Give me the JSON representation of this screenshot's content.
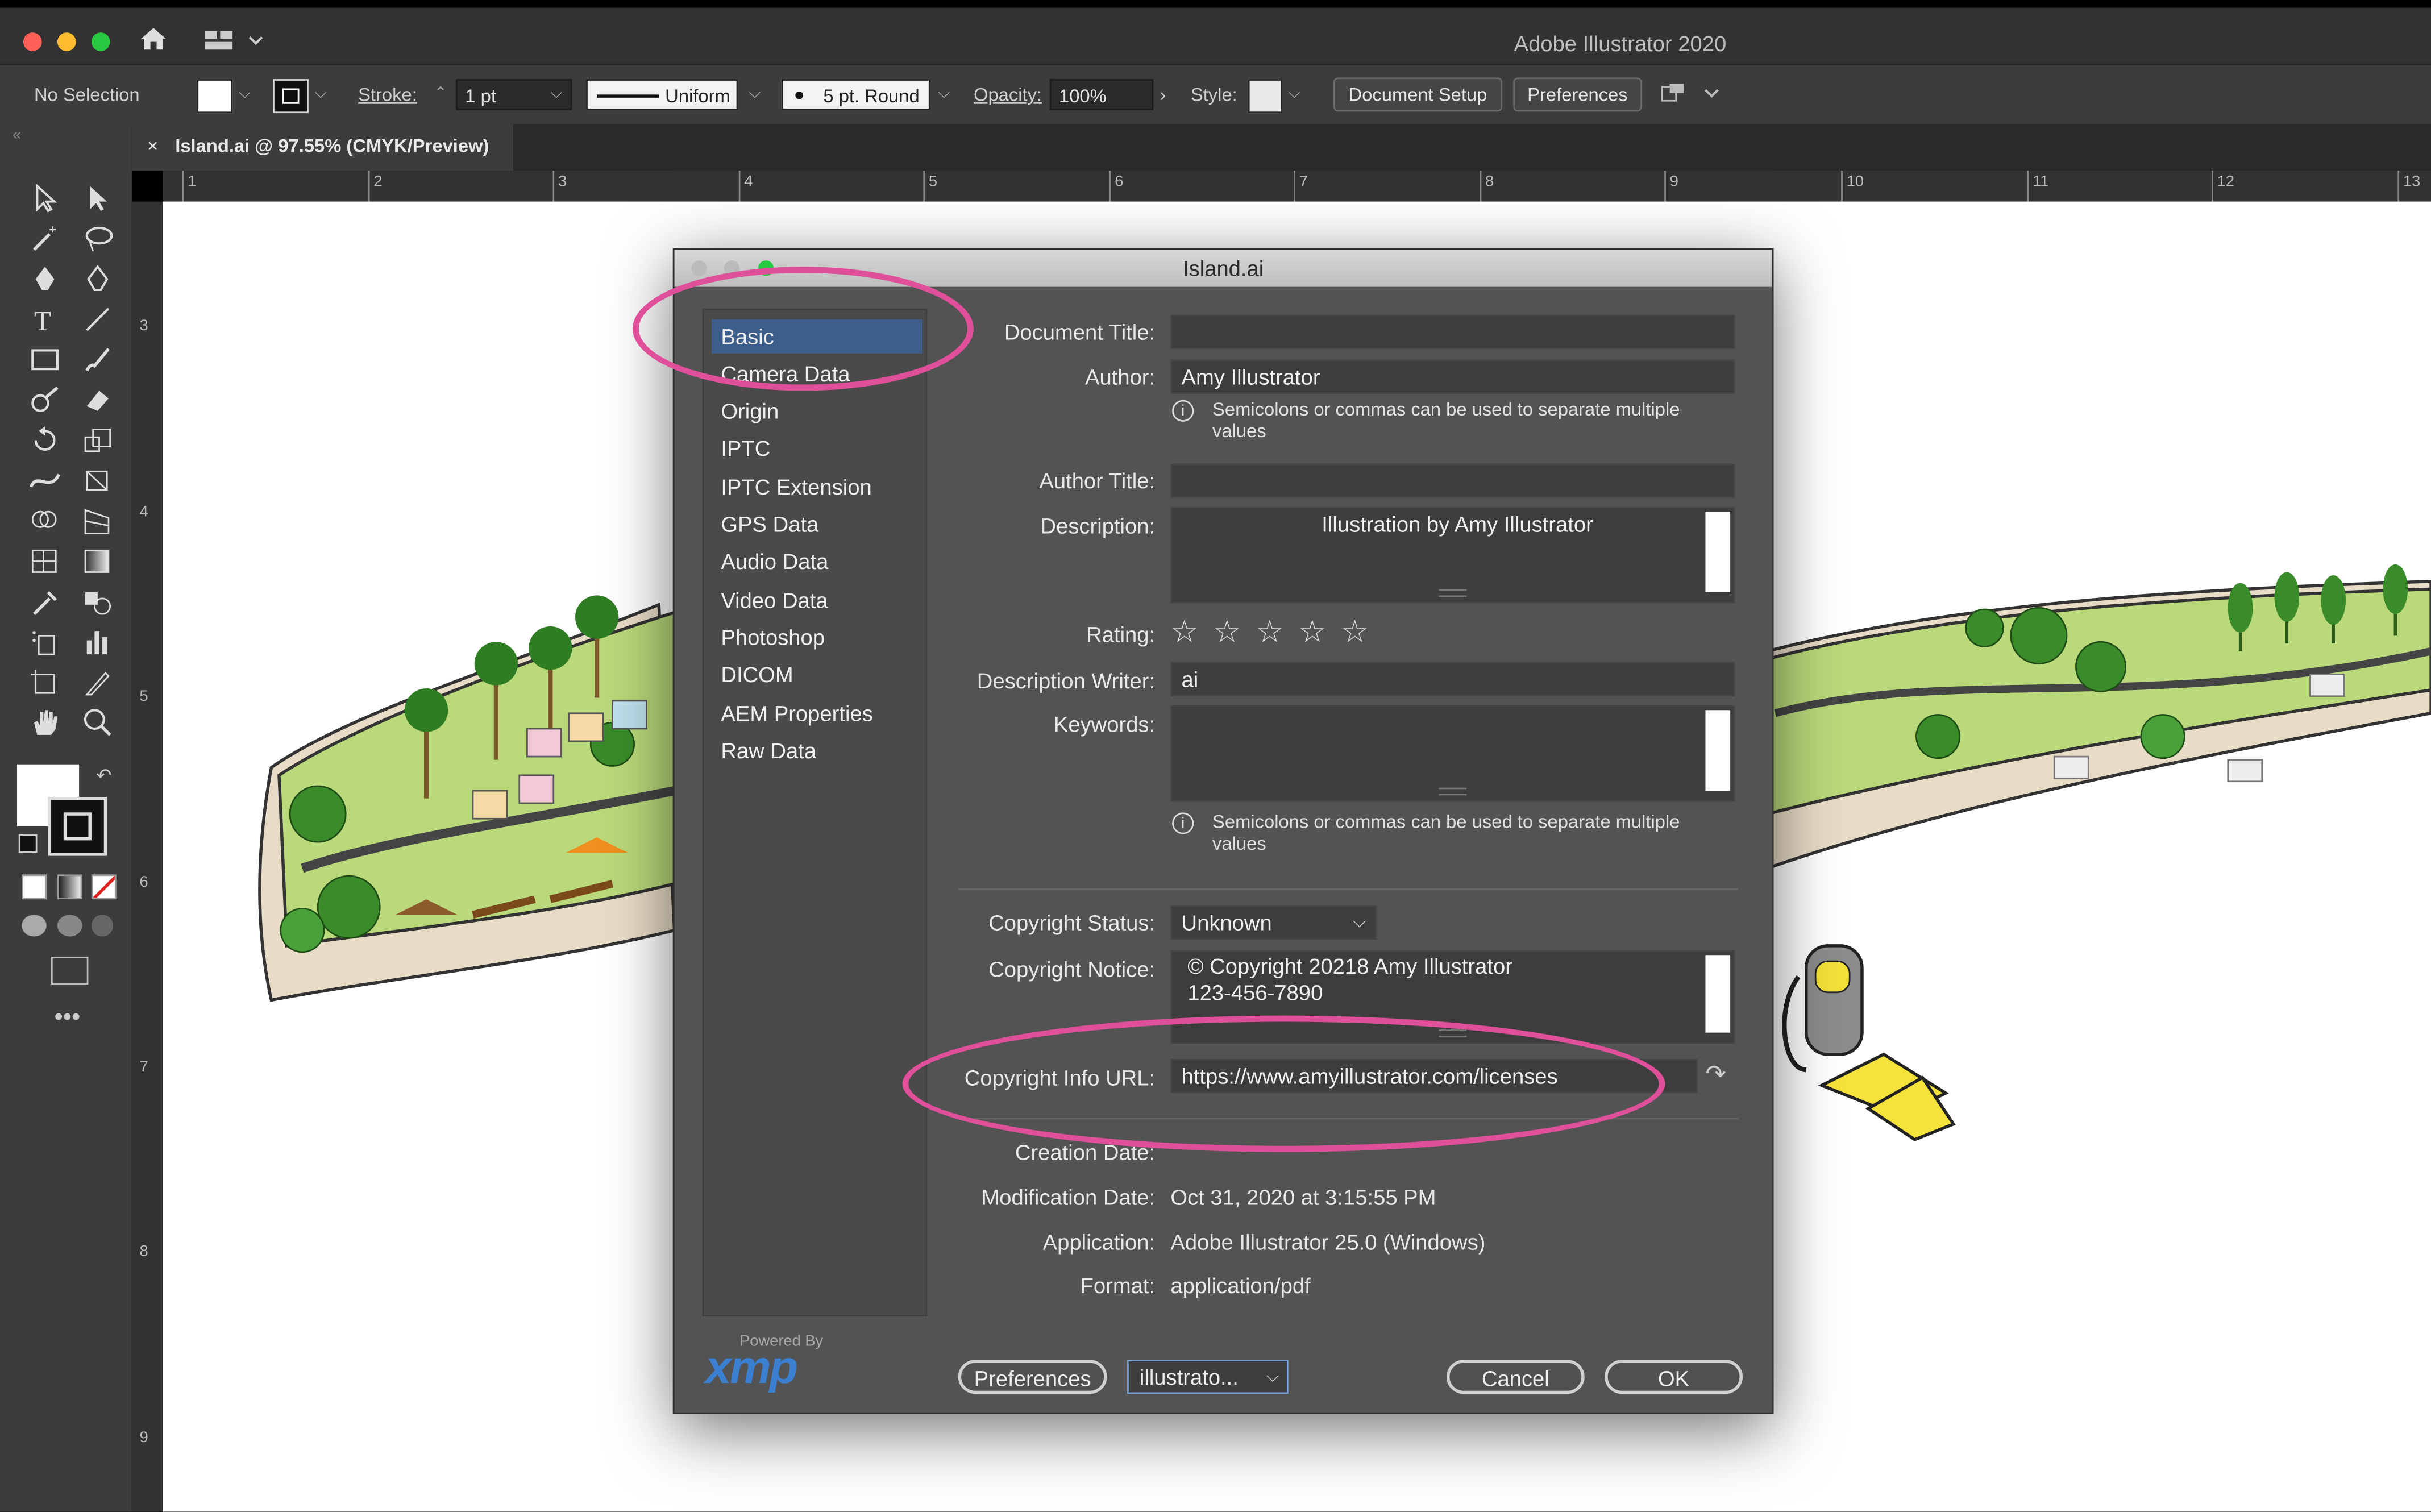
{
  "app": {
    "title": "Adobe Illustrator 2020"
  },
  "control_bar": {
    "selection": "No Selection",
    "stroke_label": "Stroke:",
    "stroke_weight": "1 pt",
    "stroke_profile": "Uniform",
    "brush": "5 pt. Round",
    "opacity_label": "Opacity:",
    "opacity_value": "100%",
    "style_label": "Style:",
    "document_setup": "Document Setup",
    "preferences": "Preferences"
  },
  "tab": {
    "close": "×",
    "label": "Island.ai @ 97.55% (CMYK/Preview)"
  },
  "ruler": {
    "h_ticks": [
      "1",
      "2",
      "3",
      "4",
      "5",
      "6",
      "7",
      "8",
      "9",
      "10",
      "11",
      "12",
      "13"
    ],
    "v_ticks": [
      "3",
      "4",
      "5",
      "6",
      "7",
      "8",
      "9"
    ]
  },
  "dialog": {
    "title": "Island.ai",
    "sidebar": [
      "Basic",
      "Camera Data",
      "Origin",
      "IPTC",
      "IPTC Extension",
      "GPS Data",
      "Audio Data",
      "Video Data",
      "Photoshop",
      "DICOM",
      "AEM Properties",
      "Raw Data"
    ],
    "labels": {
      "document_title": "Document Title:",
      "author": "Author:",
      "author_title": "Author Title:",
      "description": "Description:",
      "rating": "Rating:",
      "description_writer": "Description Writer:",
      "keywords": "Keywords:",
      "copyright_status": "Copyright Status:",
      "copyright_notice": "Copyright Notice:",
      "copyright_info_url": "Copyright Info URL:",
      "creation_date": "Creation Date:",
      "modification_date": "Modification Date:",
      "application": "Application:",
      "format": "Format:"
    },
    "values": {
      "document_title": "",
      "author": "Amy Illustrator",
      "author_title": "",
      "description": "Illustration by Amy Illustrator",
      "rating_stars": "☆ ☆ ☆ ☆ ☆",
      "description_writer": "ai",
      "keywords": "",
      "copyright_status": "Unknown",
      "copyright_notice_line1": "© Copyright 20218 Amy Illustrator",
      "copyright_notice_line2": "123-456-7890",
      "copyright_info_url": "https://www.amyillustrator.com/licenses",
      "modification_date": "Oct 31, 2020 at 3:15:55 PM",
      "application": "Adobe Illustrator 25.0 (Windows)",
      "format": "application/pdf"
    },
    "notes": {
      "author_note_line1": "Semicolons or commas can be used to separate multiple",
      "author_note_line2": "values",
      "keywords_note_line1": "Semicolons or commas can be used to separate multiple",
      "keywords_note_line2": "values"
    },
    "footer": {
      "powered_by": "Powered By",
      "xmp": "xmp",
      "preferences": "Preferences",
      "template_select": "illustrato...",
      "cancel": "Cancel",
      "ok": "OK"
    }
  },
  "colors": {
    "highlight_ring": "#e0509a",
    "selection_blue": "#3d5e8a"
  }
}
